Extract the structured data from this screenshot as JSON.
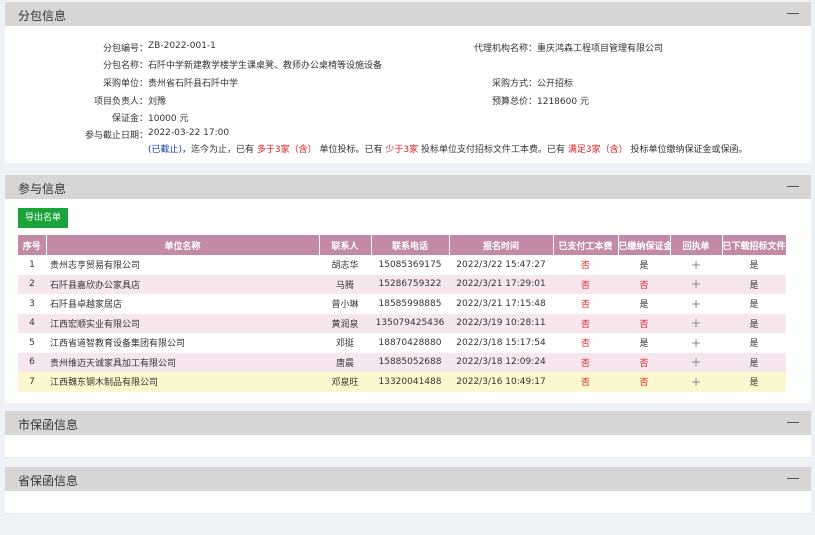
{
  "sections": {
    "package": "分包信息",
    "participants": "参与信息",
    "city_guarantee": "市保函信息",
    "province_guarantee": "省保函信息"
  },
  "package_info": {
    "package_no_label": "分包编号：",
    "package_no": "ZB-2022-001-1",
    "agency_label": "代理机构名称：",
    "agency": "重庆鸿森工程项目管理有限公司",
    "package_name_label": "分包名称：",
    "package_name": "石阡中学新建教学楼学生课桌凳、教师办公桌椅等设施设备",
    "buyer_label": "采购单位：",
    "buyer": "贵州省石阡县石阡中学",
    "method_label": "采购方式：",
    "method": "公开招标",
    "manager_label": "项目负责人：",
    "manager": "刘豫",
    "budget_label": "预算总价：",
    "budget": "1218600 元",
    "deposit_label": "保证金：",
    "deposit": "10000 元",
    "deadline_label": "参与截止日期：",
    "deadline": "2022-03-22 17:00",
    "status": "(已截止)",
    "notice_1": "，迄今为止，已有",
    "notice_2": "多于3家（含）",
    "notice_3": "单位投标。已有",
    "notice_4": "少于3家",
    "notice_5": "投标单位支付招标文件工本费。已有",
    "notice_6": "满足3家（含）",
    "notice_7": "投标单位缴纳保证金或保函。"
  },
  "export_button": "导出名单",
  "table": {
    "headers": [
      "序号",
      "单位名称",
      "联系人",
      "联系电话",
      "报名时间",
      "已支付工本费",
      "已缴纳保证金",
      "回执单",
      "已下载招标文件"
    ],
    "rows": [
      [
        "1",
        "贵州志亨贸易有限公司",
        "胡志华",
        "15085369175",
        "2022/3/22 15:47:27",
        "否",
        "是",
        "+",
        "是"
      ],
      [
        "2",
        "石阡县嘉欣办公家具店",
        "马腾",
        "15286759322",
        "2022/3/21 17:29:01",
        "否",
        "否",
        "+",
        "是"
      ],
      [
        "3",
        "石阡县卓越家居店",
        "曾小琳",
        "18585998885",
        "2022/3/21 17:15:48",
        "否",
        "是",
        "+",
        "是"
      ],
      [
        "4",
        "江西宏顺实业有限公司",
        "黄润泉",
        "135079425436",
        "2022/3/19 10:28:11",
        "否",
        "否",
        "+",
        "是"
      ],
      [
        "5",
        "江西省道智教育设备集团有限公司",
        "邓挺",
        "18870428880",
        "2022/3/18 15:17:54",
        "否",
        "是",
        "+",
        "是"
      ],
      [
        "6",
        "贵州维迈天诚家具加工有限公司",
        "唐晨",
        "15885052688",
        "2022/3/18 12:09:24",
        "否",
        "否",
        "+",
        "是"
      ],
      [
        "7",
        "江西魏东钢木制品有限公司",
        "邓泉旺",
        "13320041488",
        "2022/3/16 10:49:17",
        "否",
        "否",
        "+",
        "是"
      ]
    ]
  },
  "colors": {
    "header_bar": "#d6d6d6",
    "table_header": "#c28aa7",
    "row_alt": "#f6e7ee",
    "row_highlight": "#fbf8cf",
    "export_button": "#1aa33a",
    "red": "#e02020",
    "blue": "#1a3fb0"
  },
  "icons": [
    "collapse-icon",
    "plus-icon"
  ]
}
